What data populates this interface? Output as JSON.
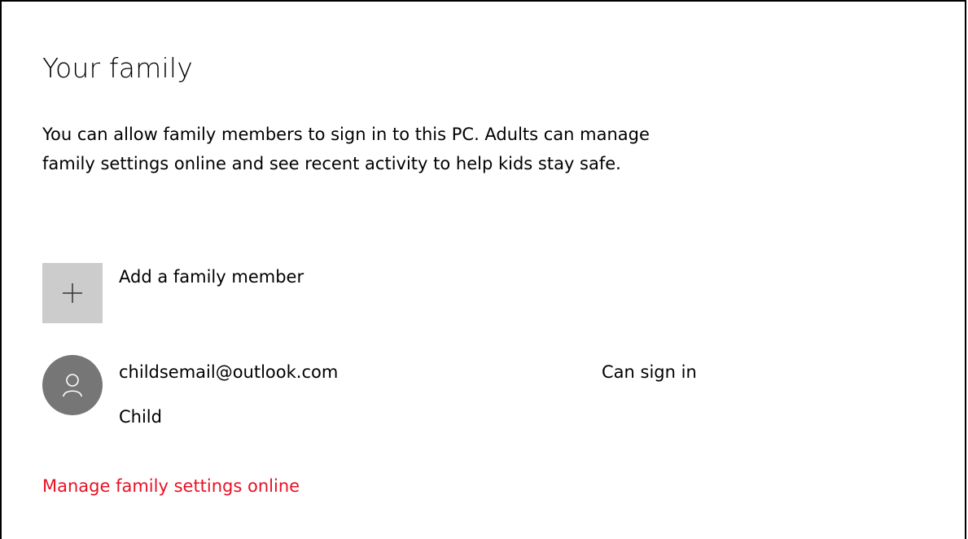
{
  "page": {
    "title": "Your family",
    "description": "You can allow family members to sign in to this PC. Adults can manage family settings online and see recent activity to help kids stay safe."
  },
  "add_member": {
    "label": "Add a family member",
    "icon": "plus-icon"
  },
  "members": [
    {
      "email": "childsemail@outlook.com",
      "status": "Can sign in",
      "role": "Child",
      "icon": "person-icon"
    }
  ],
  "links": {
    "manage_online": "Manage family settings online"
  },
  "colors": {
    "link": "#e81123",
    "add_tile": "#cccccc",
    "avatar": "#767676"
  }
}
